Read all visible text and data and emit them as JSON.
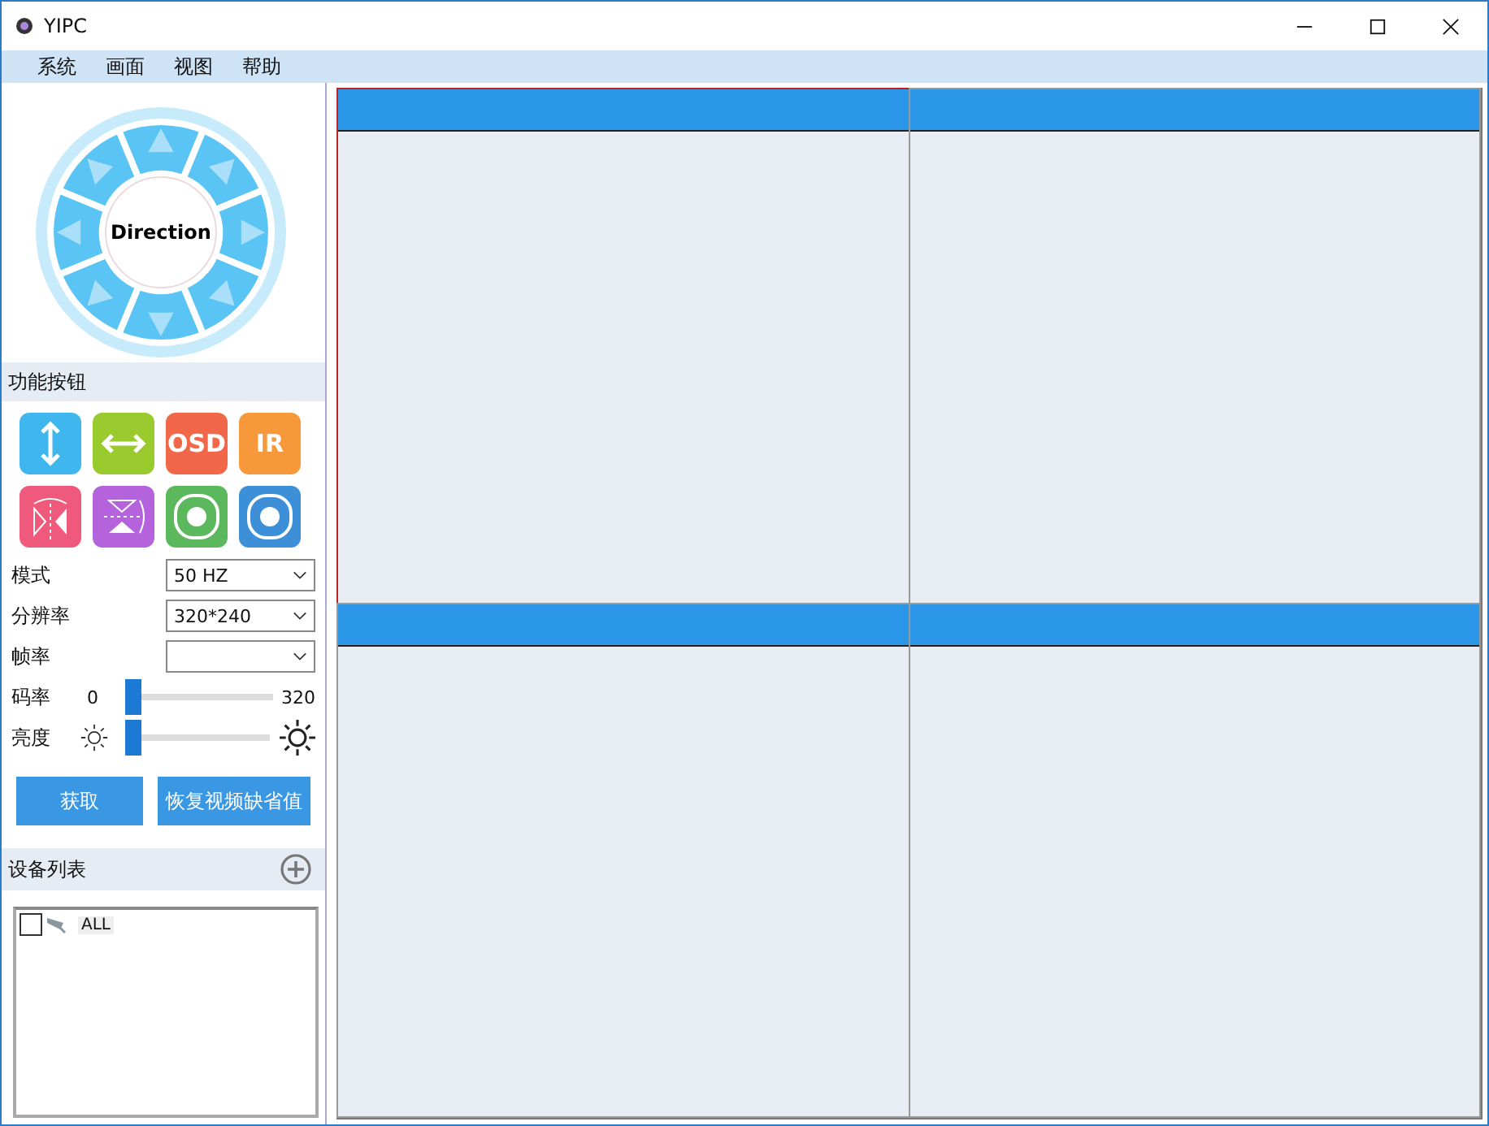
{
  "window": {
    "title": "YIPC"
  },
  "menu": [
    "系统",
    "画面",
    "视图",
    "帮助"
  ],
  "direction_pad": {
    "label": "Direction"
  },
  "function_section": {
    "title": "功能按钮"
  },
  "function_buttons": [
    {
      "kind": "vertical",
      "color": "#3fb6ee"
    },
    {
      "kind": "horizontal",
      "color": "#9acb2e"
    },
    {
      "kind": "text",
      "label": "OSD",
      "color": "#f26649"
    },
    {
      "kind": "text",
      "label": "IR",
      "color": "#f7983a"
    },
    {
      "kind": "mirror",
      "color": "#ef5a7c"
    },
    {
      "kind": "flip",
      "color": "#b563dc"
    },
    {
      "kind": "record",
      "color": "#5cb85c"
    },
    {
      "kind": "record",
      "color": "#3d8fd8"
    }
  ],
  "settings": [
    {
      "kind": "select",
      "label": "模式",
      "value": "50 HZ"
    },
    {
      "kind": "select",
      "label": "分辨率",
      "value": "320*240"
    },
    {
      "kind": "select",
      "label": "帧率"
    },
    {
      "kind": "range",
      "label": "码率",
      "min": "0",
      "max": "320",
      "level": 0
    },
    {
      "kind": "brightness",
      "label": "亮度",
      "level": 0
    }
  ],
  "actions": [
    "获取",
    "恢复视频缺省值"
  ],
  "device_list": {
    "title": "设备列表",
    "items": [
      {
        "label": "ALL",
        "checked": false
      }
    ]
  },
  "video_cells": [
    {
      "selected": true
    },
    {
      "selected": false
    },
    {
      "selected": false
    },
    {
      "selected": false
    }
  ]
}
